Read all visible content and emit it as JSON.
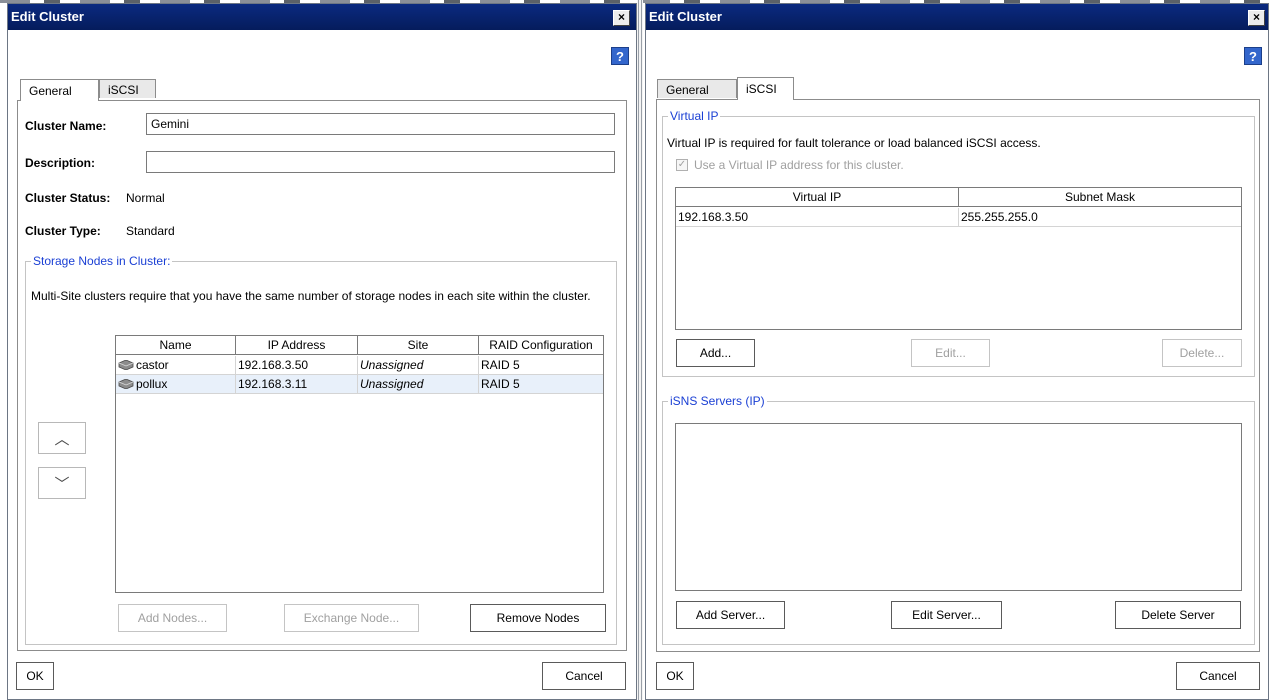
{
  "dialogs": {
    "left": {
      "title": "Edit Cluster",
      "close_glyph": "×",
      "help_glyph": "?",
      "tabs": [
        "General",
        "iSCSI"
      ],
      "active_tab": "General",
      "fields": {
        "cluster_name_label": "Cluster Name:",
        "cluster_name_value": "Gemini",
        "description_label": "Description:",
        "description_value": "",
        "cluster_status_label": "Cluster Status:",
        "cluster_status_value": "Normal",
        "cluster_type_label": "Cluster Type:",
        "cluster_type_value": "Standard"
      },
      "storage_group": {
        "legend": "Storage Nodes in Cluster:",
        "description": "Multi-Site clusters require that you have the same number of storage nodes in each site within the cluster.",
        "columns": [
          "Name",
          "IP Address",
          "Site",
          "RAID Configuration"
        ],
        "rows": [
          {
            "name": "castor",
            "ip": "192.168.3.50",
            "site": "Unassigned",
            "raid": "RAID 5"
          },
          {
            "name": "pollux",
            "ip": "192.168.3.11",
            "site": "Unassigned",
            "raid": "RAID 5"
          }
        ],
        "buttons": {
          "add_nodes": "Add Nodes...",
          "exchange_node": "Exchange Node...",
          "remove_nodes": "Remove Nodes"
        },
        "move_up_glyph": "︿",
        "move_down_glyph": "﹀"
      },
      "footer": {
        "ok": "OK",
        "cancel": "Cancel"
      }
    },
    "right": {
      "title": "Edit Cluster",
      "close_glyph": "×",
      "help_glyph": "?",
      "tabs": [
        "General",
        "iSCSI"
      ],
      "active_tab": "iSCSI",
      "virtual_ip": {
        "legend": "Virtual IP",
        "description": "Virtual IP is required for fault tolerance or load balanced iSCSI access.",
        "checkbox_label": "Use a Virtual IP address for this cluster.",
        "checkbox_checked": true,
        "columns": [
          "Virtual IP",
          "Subnet Mask"
        ],
        "rows": [
          {
            "ip": "192.168.3.50",
            "mask": "255.255.255.0"
          }
        ],
        "buttons": {
          "add": "Add...",
          "edit": "Edit...",
          "delete": "Delete..."
        }
      },
      "isns": {
        "legend": "iSNS Servers (IP)",
        "buttons": {
          "add": "Add Server...",
          "edit": "Edit Server...",
          "delete": "Delete Server"
        }
      },
      "footer": {
        "ok": "OK",
        "cancel": "Cancel"
      }
    }
  }
}
